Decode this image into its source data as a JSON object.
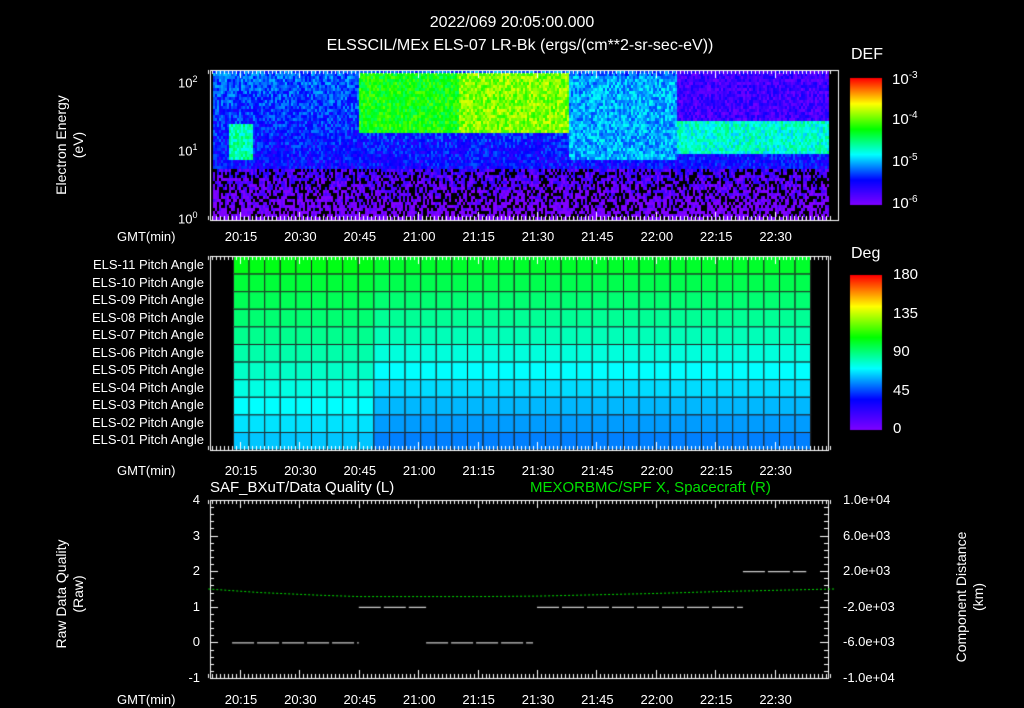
{
  "header": {
    "title": "2022/069 20:05:00.000",
    "subtitle": "ELSSCIL/MEx ELS-07 LR-Bk  (ergs/(cm**2-sr-sec-eV))"
  },
  "time_label": "GMT(min)",
  "time_ticks": [
    "20:15",
    "20:30",
    "20:45",
    "21:00",
    "21:15",
    "21:30",
    "21:45",
    "22:00",
    "22:15",
    "22:30"
  ],
  "chart_data": [
    {
      "type": "heatmap",
      "title": "ELSSCIL/MEx ELS-07 LR-Bk  (ergs/(cm**2-sr-sec-eV))",
      "ylabel": "Electron Energy",
      "yunit": "(eV)",
      "yscale": "log",
      "ylim": [
        1,
        150
      ],
      "ytick_labels": [
        "10",
        "10",
        "10"
      ],
      "ytick_exps": [
        "2",
        "1",
        "0"
      ],
      "colorbar": {
        "label": "DEF",
        "scale": "log",
        "range": [
          1e-06,
          0.001
        ],
        "tick_labels": [
          "10",
          "10",
          "10",
          "10"
        ],
        "tick_exps": [
          "-3",
          "-4",
          "-5",
          "-6"
        ]
      },
      "regions": [
        {
          "time": [
            "20:12",
            "20:18"
          ],
          "energy_eV": [
            8,
            25
          ],
          "log10_def": -4.6
        },
        {
          "time": [
            "20:45",
            "21:10"
          ],
          "energy_eV": [
            20,
            140
          ],
          "log10_def": -4.2
        },
        {
          "time": [
            "21:10",
            "21:38"
          ],
          "energy_eV": [
            20,
            140
          ],
          "log10_def": -3.9
        },
        {
          "time": [
            "21:38",
            "22:05"
          ],
          "energy_eV": [
            8,
            130
          ],
          "log10_def": -5.0
        },
        {
          "time": [
            "22:05",
            "22:45"
          ],
          "energy_eV": [
            10,
            28
          ],
          "log10_def": -4.7
        }
      ]
    },
    {
      "type": "heatmap",
      "colorbar": {
        "label": "Deg",
        "range": [
          0,
          180
        ],
        "tick_labels": [
          "180",
          "135",
          "90",
          "45",
          "0"
        ]
      },
      "rows": [
        "ELS-11 Pitch Angle",
        "ELS-10 Pitch Angle",
        "ELS-09 Pitch Angle",
        "ELS-08 Pitch Angle",
        "ELS-07 Pitch Angle",
        "ELS-06 Pitch Angle",
        "ELS-05 Pitch Angle",
        "ELS-04 Pitch Angle",
        "ELS-03 Pitch Angle",
        "ELS-02 Pitch Angle",
        "ELS-01 Pitch Angle"
      ],
      "pitch_early_deg": [
        105,
        100,
        96,
        92,
        88,
        84,
        80,
        76,
        72,
        68,
        64
      ],
      "pitch_late_deg": [
        102,
        97,
        92,
        87,
        82,
        77,
        72,
        67,
        62,
        58,
        54
      ],
      "time_range": [
        "20:13",
        "22:39"
      ],
      "transition": "20:45"
    },
    {
      "type": "line",
      "title_left": "SAF_BXuT/Data Quality (L)",
      "title_right": "MEXORBMC/SPF X, Spacecraft (R)",
      "ylabel_left": "Raw Data Quality",
      "yunit_left": "(Raw)",
      "ylim_left": [
        -1,
        4
      ],
      "yticks_left": [
        "4",
        "3",
        "2",
        "1",
        "0",
        "-1"
      ],
      "ylabel_right": "Component Distance",
      "yunit_right": "(km)",
      "ylim_right": [
        -10000,
        10000
      ],
      "yticks_right": [
        "1.0e+04",
        "6.0e+03",
        "2.0e+03",
        "-2.0e+03",
        "-6.0e+03",
        "-1.0e+04"
      ],
      "series": [
        {
          "name": "Data Quality",
          "color": "#ffffff",
          "segments": [
            {
              "from": "20:13",
              "to": "20:45",
              "value": 0
            },
            {
              "from": "20:45",
              "to": "21:02",
              "value": 1
            },
            {
              "from": "21:02",
              "to": "21:29",
              "value": 0
            },
            {
              "from": "21:30",
              "to": "22:22",
              "value": 1
            },
            {
              "from": "22:22",
              "to": "22:38",
              "value": 2
            }
          ]
        },
        {
          "name": "SPF X",
          "color": "#00e000",
          "times": [
            "20:07",
            "20:20",
            "20:35",
            "20:45",
            "21:15",
            "21:30",
            "21:45",
            "22:00",
            "22:15",
            "22:30",
            "22:45"
          ],
          "values": [
            0,
            -400,
            -700,
            -850,
            -850,
            -800,
            -650,
            -500,
            -300,
            -150,
            0
          ]
        }
      ]
    }
  ]
}
